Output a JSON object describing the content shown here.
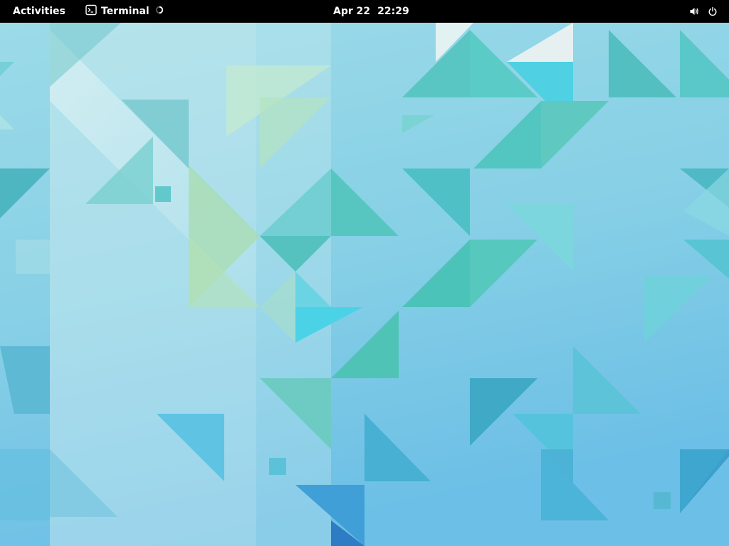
{
  "topbar": {
    "activities_label": "Activities",
    "app_name": "Terminal",
    "app_icon": "terminal-icon",
    "date": "Apr 22",
    "time": "22:29",
    "tray_icons": [
      "volume-icon",
      "power-icon"
    ]
  },
  "wallpaper": {
    "colors": {
      "base": "#8fd4e6",
      "light": "#c6ecf2",
      "cyan": "#5ccfe6",
      "teal": "#4ec3c4",
      "blue": "#46a8dc",
      "green": "#9ed9b0",
      "white": "#e4f2f4"
    }
  }
}
